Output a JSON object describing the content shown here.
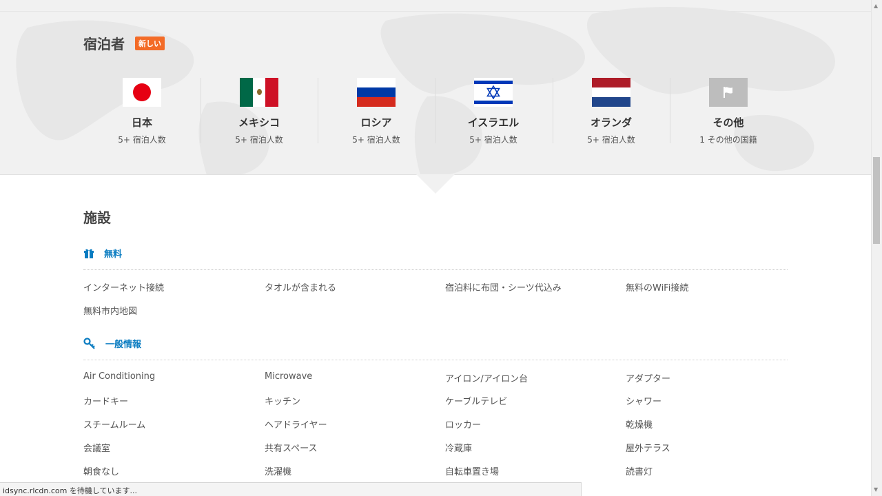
{
  "guests": {
    "title": "宿泊者",
    "badge": "新しい",
    "countries": [
      {
        "name": "日本",
        "count": "5+ 宿泊人数",
        "flag": "japan-flag-icon"
      },
      {
        "name": "メキシコ",
        "count": "5+ 宿泊人数",
        "flag": "mexico-flag-icon"
      },
      {
        "name": "ロシア",
        "count": "5+ 宿泊人数",
        "flag": "russia-flag-icon"
      },
      {
        "name": "イスラエル",
        "count": "5+ 宿泊人数",
        "flag": "israel-flag-icon"
      },
      {
        "name": "オランダ",
        "count": "5+ 宿泊人数",
        "flag": "netherlands-flag-icon"
      },
      {
        "name": "その他",
        "count": "1  その他の国籍",
        "flag": "white-flag-icon"
      }
    ]
  },
  "facilities": {
    "title": "施設",
    "categories": [
      {
        "label": "無料",
        "icon": "gift-icon",
        "items": [
          "インターネット接続",
          "タオルが含まれる",
          "宿泊料に布団・シーツ代込み",
          "無料のWiFi接続",
          "無料市内地図"
        ]
      },
      {
        "label": "一般情報",
        "icon": "key-icon",
        "items": [
          "Air Conditioning",
          "Microwave",
          "アイロン/アイロン台",
          "アダプター",
          "カードキー",
          "キッチン",
          "ケーブルテレビ",
          "シャワー",
          "スチームルーム",
          "ヘアドライヤー",
          "ロッカー",
          "乾燥機",
          "会議室",
          "共有スペース",
          "冷蔵庫",
          "屋外テラス",
          "朝食なし",
          "洗濯機",
          "自転車置き場",
          "読書灯"
        ]
      }
    ]
  },
  "status_bar": "idsync.rlcdn.com を待機しています...",
  "colors": {
    "accent": "#0a7cc1",
    "badge": "#f36b27",
    "band": "#f1f1f1"
  }
}
